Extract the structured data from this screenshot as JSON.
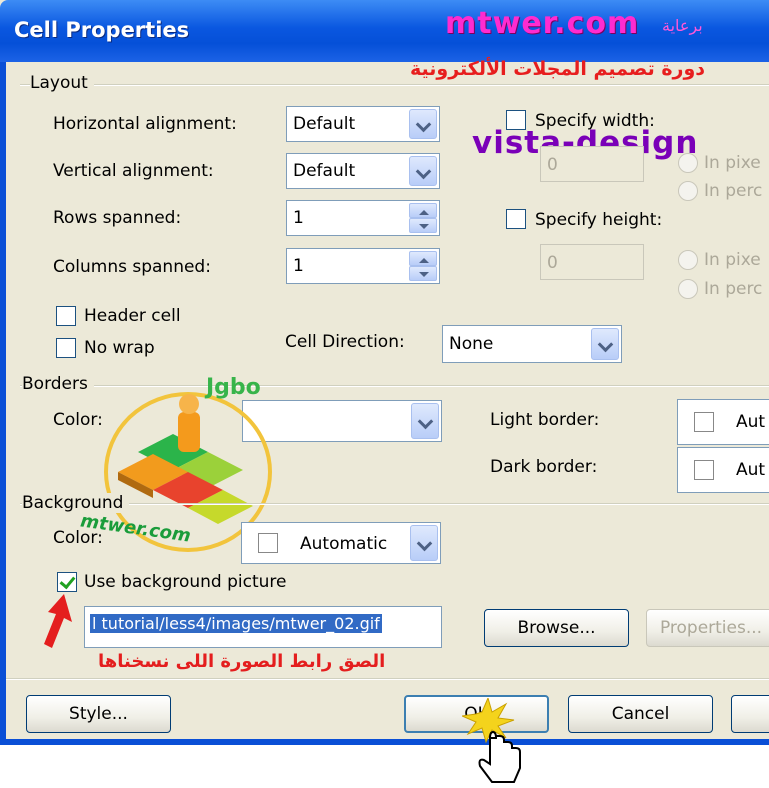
{
  "window": {
    "title": "Cell Properties"
  },
  "watermarks": {
    "site": "mtwer.com",
    "site_prefix": "برعاية",
    "course": "دورة تصميم المجلات الألكترونية",
    "brand": "vista-design",
    "logo_text": "Jgbo",
    "logo_site": "mtwer.com"
  },
  "layout": {
    "group_label": "Layout",
    "horizontal_alignment": {
      "label": "Horizontal alignment:",
      "value": "Default"
    },
    "vertical_alignment": {
      "label": "Vertical alignment:",
      "value": "Default"
    },
    "rows_spanned": {
      "label": "Rows spanned:",
      "value": "1"
    },
    "columns_spanned": {
      "label": "Columns spanned:",
      "value": "1"
    },
    "specify_width": {
      "label": "Specify width:",
      "checked": false,
      "value": "0",
      "in_pixels": "In pixe",
      "in_percent": "In perc"
    },
    "specify_height": {
      "label": "Specify height:",
      "checked": false,
      "value": "0",
      "in_pixels": "In pixe",
      "in_percent": "In perc"
    },
    "header_cell": {
      "label": "Header cell",
      "checked": false
    },
    "no_wrap": {
      "label": "No wrap",
      "checked": false
    },
    "cell_direction": {
      "label": "Cell Direction:",
      "value": "None"
    }
  },
  "borders": {
    "group_label": "Borders",
    "color_label": "Color:",
    "color_value": "",
    "light_border": {
      "label": "Light border:",
      "value": "Aut"
    },
    "dark_border": {
      "label": "Dark border:",
      "value": "Aut"
    }
  },
  "background": {
    "group_label": "Background",
    "color_label": "Color:",
    "color_value": "Automatic",
    "use_picture": {
      "label": "Use background picture",
      "checked": true
    },
    "picture_path": "l tutorial/less4/images/mtwer_02.gif",
    "browse_label": "Browse...",
    "properties_label": "Properties..."
  },
  "annotation": {
    "paste_hint": "الصق رابط الصورة اللى نسخناها"
  },
  "buttons": {
    "style": "Style...",
    "ok": "OK",
    "cancel": "Cancel"
  },
  "colors": {
    "titlebar": "#0550d8",
    "dialog": "#ece9d8",
    "selection": "#316ac5",
    "annotation": "#e41e1e"
  }
}
